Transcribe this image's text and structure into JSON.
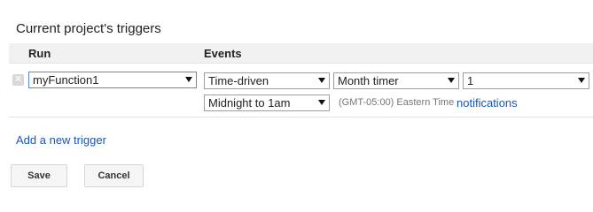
{
  "title": "Current project's triggers",
  "columns": {
    "run": "Run",
    "events": "Events"
  },
  "trigger": {
    "remove_glyph": "✕",
    "function": "myFunction1",
    "event_source": "Time-driven",
    "timer_type": "Month timer",
    "day_of_month": "1",
    "time_of_day": "Midnight to 1am",
    "timezone": "(GMT-05:00) Eastern Time",
    "notifications_label": "notifications"
  },
  "add_trigger_label": "Add a new trigger",
  "buttons": {
    "save": "Save",
    "cancel": "Cancel"
  }
}
